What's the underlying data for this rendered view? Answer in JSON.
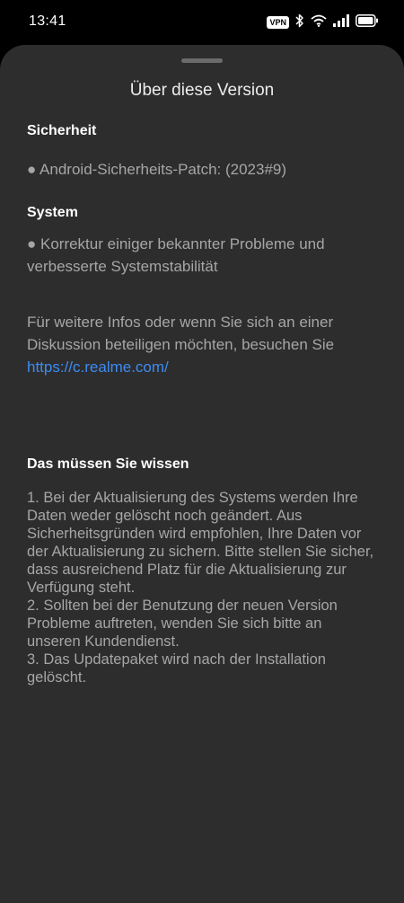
{
  "status_bar": {
    "time": "13:41",
    "vpn_label": "VPN",
    "icons": [
      "vpn-icon",
      "bluetooth-icon",
      "wifi-icon",
      "signal-icon",
      "battery-icon"
    ]
  },
  "sheet": {
    "title": "Über diese Version",
    "security": {
      "heading": "Sicherheit",
      "item": "● Android-Sicherheits-Patch: (2023#9)"
    },
    "system": {
      "heading": "System",
      "item": "● Korrektur einiger bekannter Probleme und verbesserte Systemstabilität"
    },
    "info": {
      "text": "Für weitere Infos oder wenn Sie sich an einer Diskussion beteiligen möchten, besuchen Sie",
      "link": "https://c.realme.com/"
    },
    "notice": {
      "heading": "Das müssen Sie wissen",
      "lines": [
        "1. Bei der Aktualisierung des Systems werden Ihre Daten weder gelöscht noch geändert. Aus Sicherheitsgründen wird empfohlen, Ihre Daten vor der Aktualisierung zu sichern. Bitte stellen Sie sicher, dass ausreichend Platz für die Aktualisierung zur Verfügung steht.",
        "2. Sollten bei der Benutzung der neuen Version Probleme auftreten, wenden Sie sich bitte an unseren Kundendienst.",
        "3. Das Updatepaket wird nach der Installation gelöscht."
      ]
    }
  },
  "colors": {
    "sheet_background": "#2d2d2d",
    "link": "#3d8bf2",
    "body_text": "#a6a6a6"
  }
}
